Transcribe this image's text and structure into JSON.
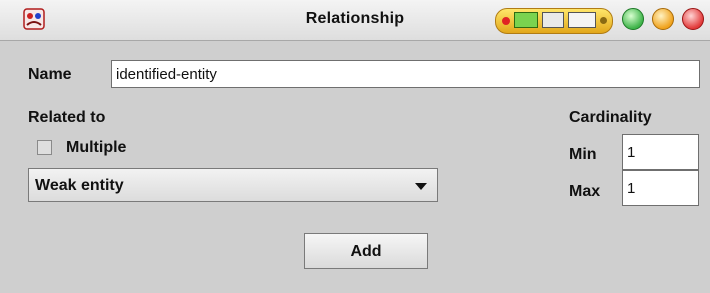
{
  "window": {
    "title": "Relationship",
    "icon": "app-icon",
    "controls": [
      "minimize-button",
      "maximize-button",
      "close-button"
    ]
  },
  "name": {
    "label": "Name",
    "value": "identified-entity"
  },
  "related_to": {
    "label": "Related to",
    "multiple_label": "Multiple",
    "multiple_checked": false,
    "selected": "Weak entity"
  },
  "cardinality": {
    "label": "Cardinality",
    "min_label": "Min",
    "min_value": "1",
    "max_label": "Max",
    "max_value": "1"
  },
  "actions": {
    "add_label": "Add"
  }
}
